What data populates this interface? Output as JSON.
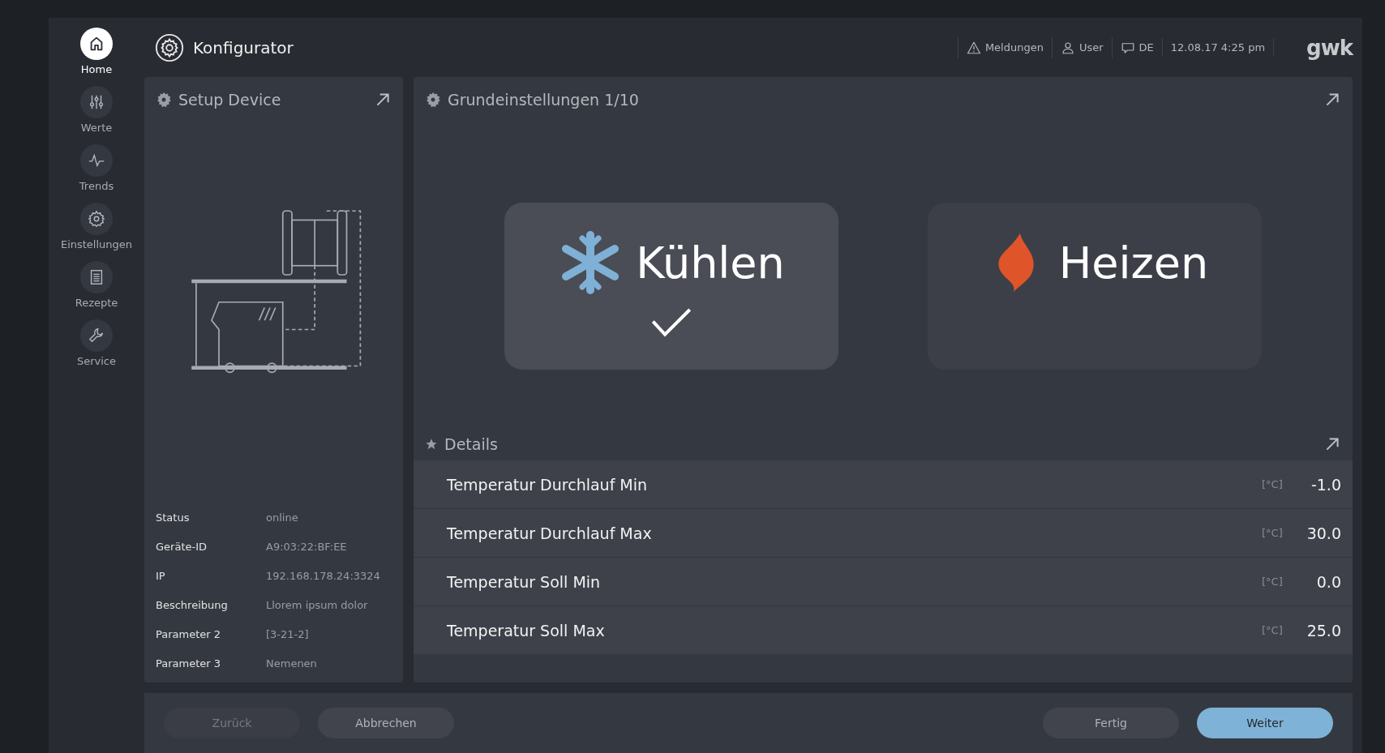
{
  "header": {
    "title": "Konfigurator",
    "messages": "Meldungen",
    "user": "User",
    "language": "DE",
    "datetime": "12.08.17 4:25 pm",
    "logo": "gwk"
  },
  "sidebar": {
    "items": [
      {
        "label": "Home",
        "selected": true
      },
      {
        "label": "Werte",
        "selected": false
      },
      {
        "label": "Trends",
        "selected": false
      },
      {
        "label": "Einstellungen",
        "selected": false
      },
      {
        "label": "Rezepte",
        "selected": false
      },
      {
        "label": "Service",
        "selected": false
      }
    ]
  },
  "setup_panel": {
    "title": "Setup Device",
    "info": [
      {
        "label": "Status",
        "value": "online"
      },
      {
        "label": "Geräte-ID",
        "value": "A9:03:22:BF:EE"
      },
      {
        "label": "IP",
        "value": "192.168.178.24:3324"
      },
      {
        "label": "Beschreibung",
        "value": "Llorem ipsum dolor"
      },
      {
        "label": "Parameter 2",
        "value": "[3-21-2]"
      },
      {
        "label": "Parameter 3",
        "value": "Nemenen"
      }
    ]
  },
  "settings_panel": {
    "title": "Grundeinstellungen 1/10",
    "modes": [
      {
        "label": "Kühlen",
        "selected": true
      },
      {
        "label": "Heizen",
        "selected": false
      }
    ]
  },
  "details": {
    "title": "Details",
    "rows": [
      {
        "label": "Temperatur Durchlauf Min",
        "unit": "[°C]",
        "value": "-1.0"
      },
      {
        "label": "Temperatur Durchlauf Max",
        "unit": "[°C]",
        "value": "30.0"
      },
      {
        "label": "Temperatur Soll Min",
        "unit": "[°C]",
        "value": "0.0"
      },
      {
        "label": "Temperatur Soll Max",
        "unit": "[°C]",
        "value": "25.0"
      }
    ]
  },
  "footer": {
    "left_buttons": [
      {
        "label": "Zurück",
        "kind": "secondary",
        "disabled": true
      },
      {
        "label": "Abbrechen",
        "kind": "secondary",
        "disabled": false
      }
    ],
    "right_buttons": [
      {
        "label": "Fertig",
        "kind": "secondary",
        "disabled": false
      },
      {
        "label": "Weiter",
        "kind": "primary",
        "disabled": false
      }
    ]
  }
}
